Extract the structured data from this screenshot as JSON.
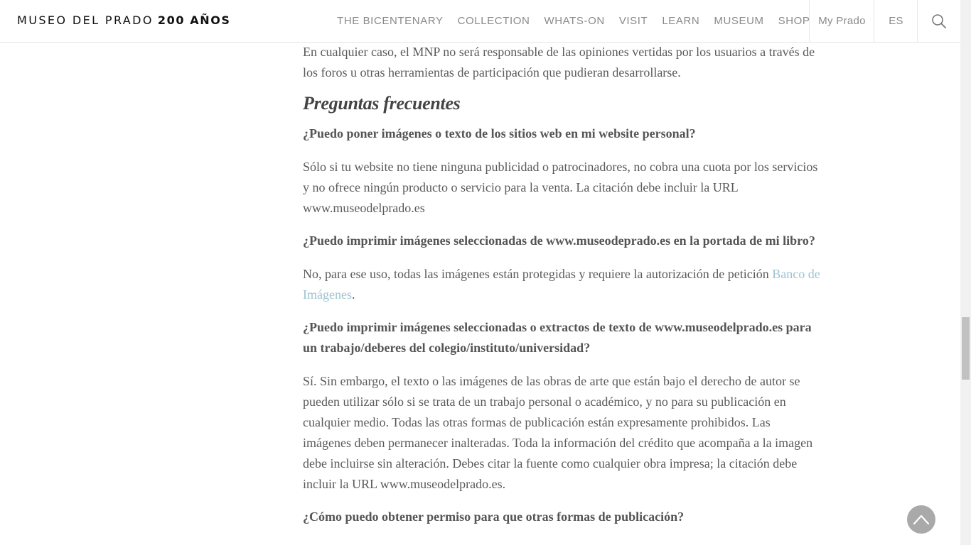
{
  "header": {
    "logo_text": "MUSEO DEL PRADO",
    "logo_strong": "200 AÑOS",
    "nav": [
      {
        "label": "THE BICENTENARY"
      },
      {
        "label": "COLLECTION"
      },
      {
        "label": "WHATS-ON"
      },
      {
        "label": "VISIT"
      },
      {
        "label": "LEARN"
      },
      {
        "label": "MUSEUM"
      },
      {
        "label": "SHOP"
      }
    ],
    "my_prado": "My Prado",
    "language": "ES",
    "search_icon": "search-icon"
  },
  "content": {
    "intro": "En cualquier caso, el MNP no será responsable de las opiniones vertidas por los usuarios a través de los foros u otras herramientas de participación que pudieran desarrollarse.",
    "faq_title": "Preguntas frecuentes",
    "faq": [
      {
        "q": "¿Puedo poner imágenes o texto de los sitios web en mi website personal?",
        "a": "Sólo si tu website no tiene ninguna publicidad o patrocinadores, no cobra una cuota por los servicios y no ofrece ningún producto o servicio para la venta. La citación debe incluir la URL www.museodelprado.es"
      },
      {
        "q": "¿Puedo imprimir imágenes seleccionadas de www.museodeprado.es en la portada de mi libro?",
        "a_before": "No, para ese uso, todas las imágenes están protegidas y requiere la autorización de petición ",
        "a_link": "Banco de Imágenes",
        "a_after": "."
      },
      {
        "q": "¿Puedo imprimir imágenes seleccionadas o extractos de texto de www.museodelprado.es para un trabajo/deberes del colegio/instituto/universidad?",
        "a": "Sí. Sin embargo, el texto o las imágenes de las obras de arte que están bajo el derecho de autor se pueden utilizar sólo si se trata de un trabajo personal o académico, y no para su publicación en cualquier medio. Todas las otras formas de publicación están expresamente prohibidos. Las imágenes deben permanecer inalteradas. Toda la información del crédito que acompaña a la imagen debe incluirse sin alteración. Debes citar la fuente como cualquier obra impresa; la citación debe incluir la URL www.museodelprado.es."
      },
      {
        "q": "¿Cómo puedo obtener permiso para que otras formas de publicación?"
      }
    ]
  },
  "back_to_top_icon": "chevron-up-icon",
  "colors": {
    "link": "#9ec3cf",
    "text": "#555555",
    "back_to_top": "#a9a9a9"
  }
}
